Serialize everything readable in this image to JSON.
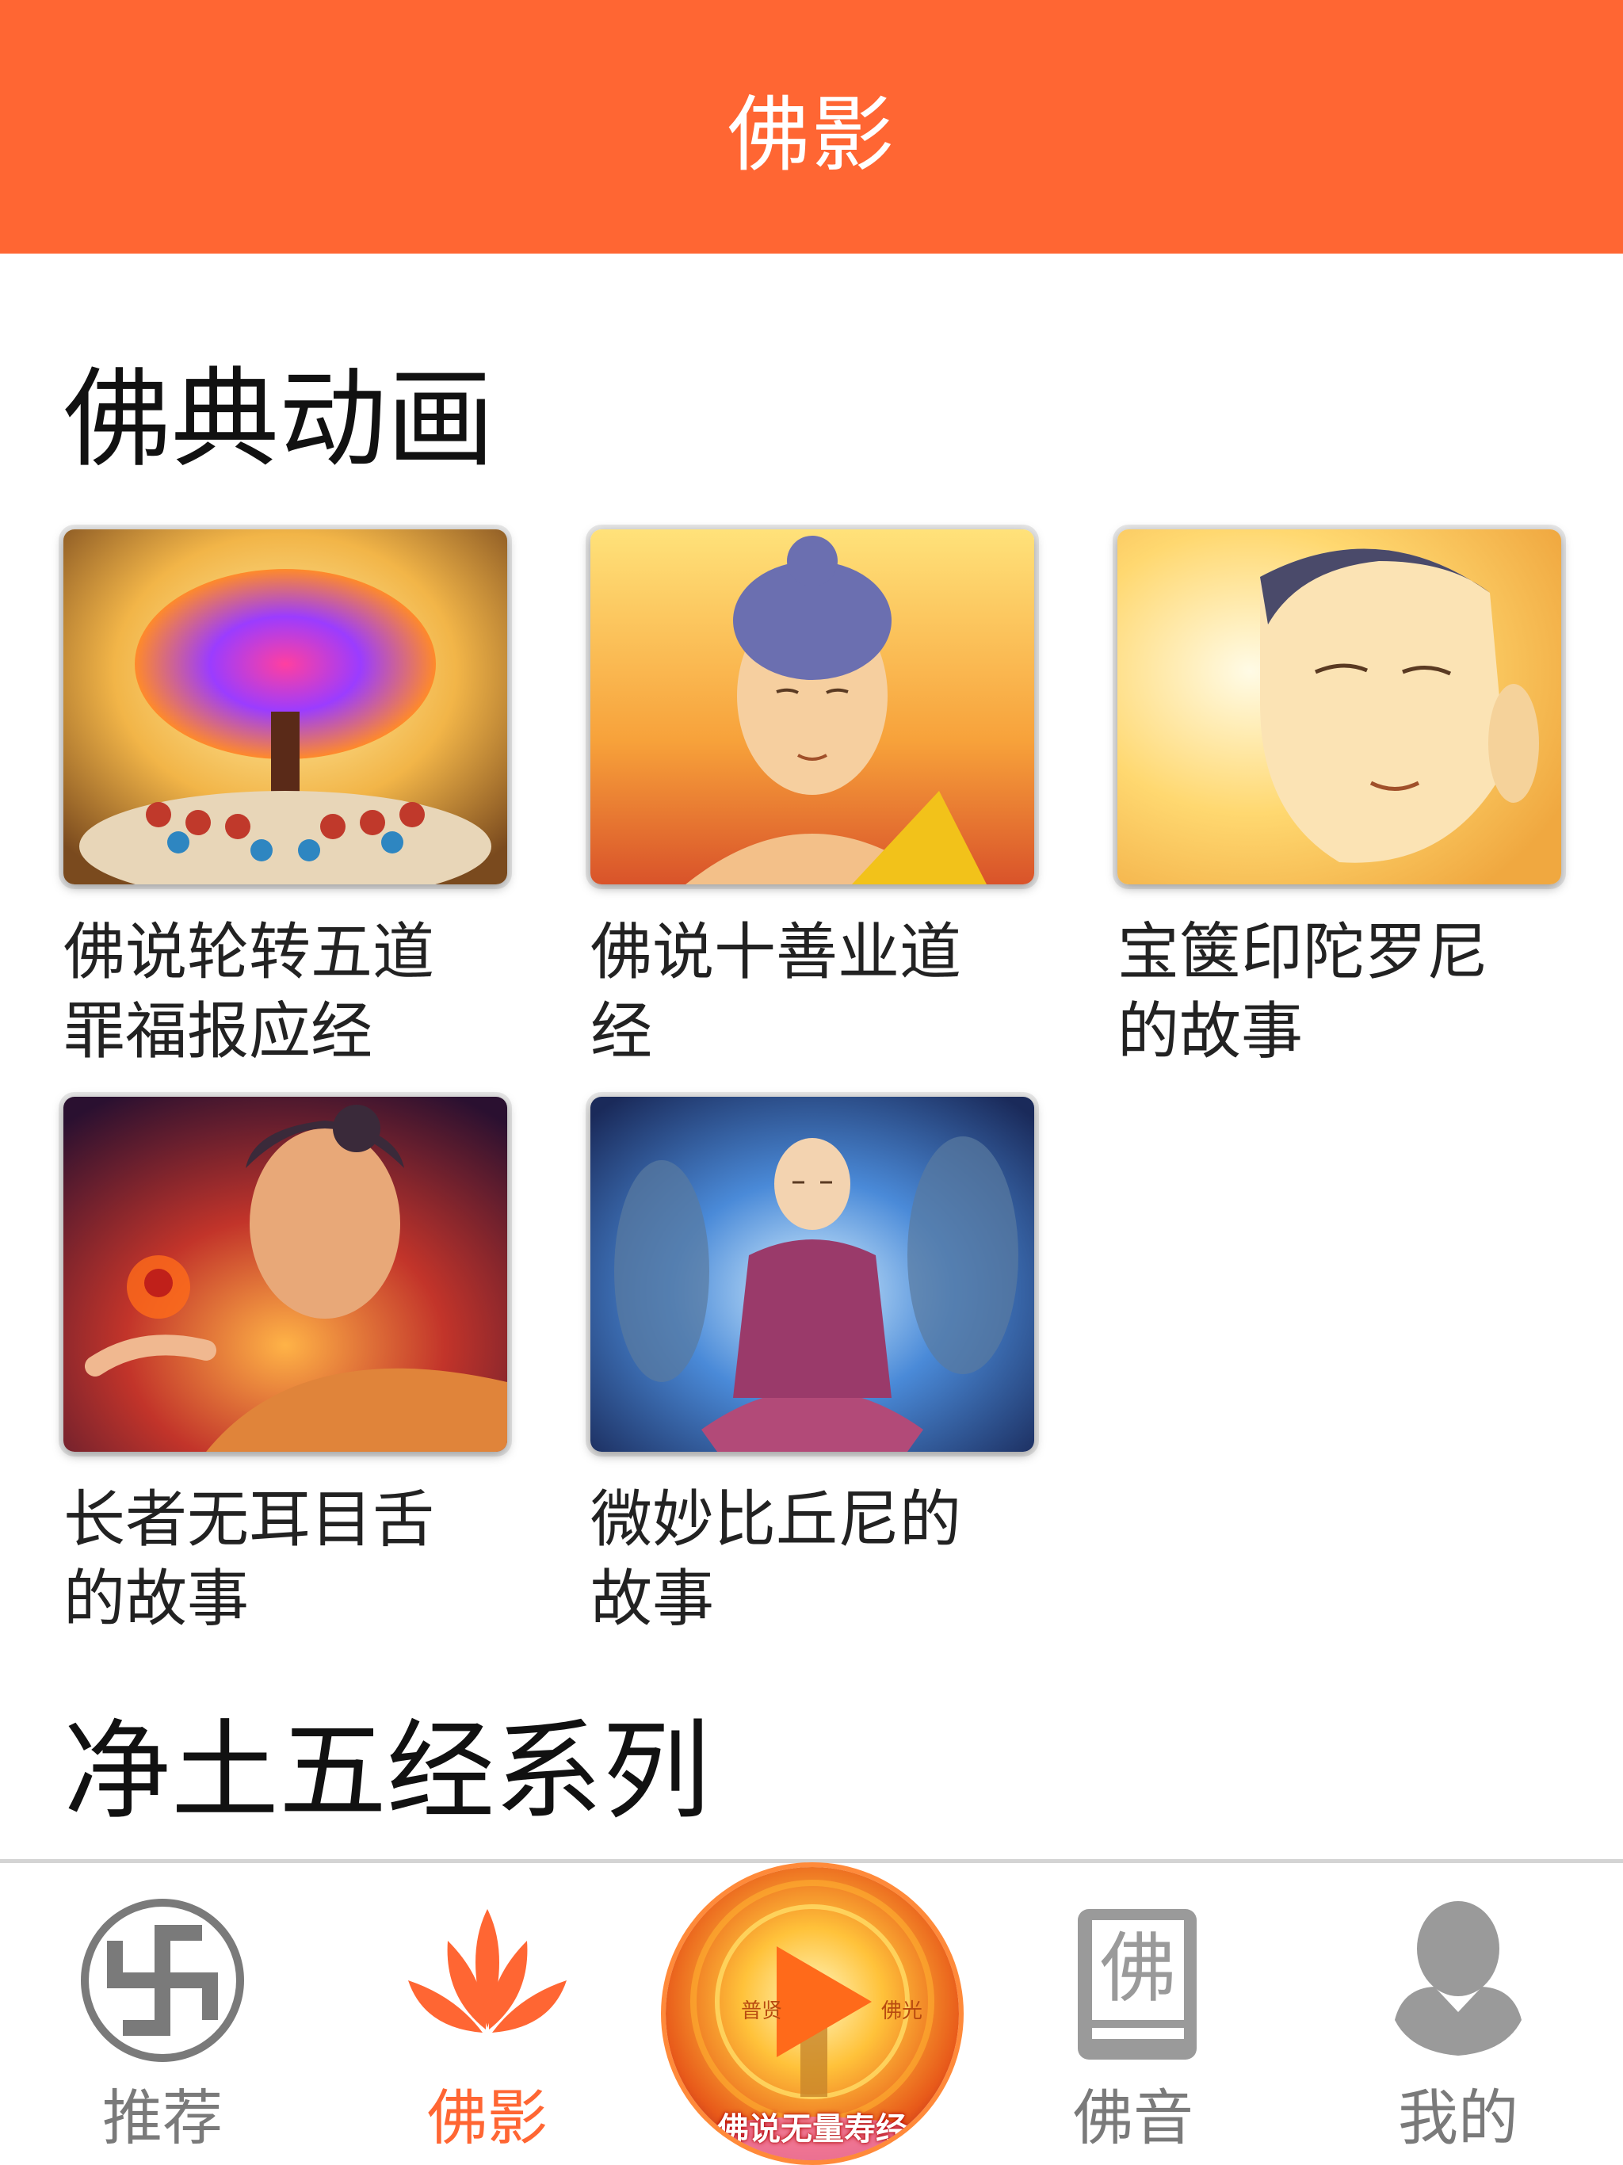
{
  "header": {
    "title": "佛影"
  },
  "sections": [
    {
      "title": "佛典动画",
      "items": [
        {
          "caption": "佛说轮转五道罪福报应经",
          "image_desc": "bodhi-tree-gathering"
        },
        {
          "caption": "佛说十善业道经",
          "image_desc": "buddha-portrait-golden"
        },
        {
          "caption": "宝箧印陀罗尼的故事",
          "image_desc": "buddha-face-light"
        },
        {
          "caption": "长者无耳目舌的故事",
          "image_desc": "buddha-cosmic-child"
        },
        {
          "caption": "微妙比丘尼的故事",
          "image_desc": "meditating-nun"
        }
      ]
    },
    {
      "title": "净土五经系列"
    }
  ],
  "bottom_nav": {
    "items": [
      {
        "label": "推荐",
        "icon": "swastika-icon",
        "active": false
      },
      {
        "label": "佛影",
        "icon": "lotus-icon",
        "active": true
      },
      {
        "label": "佛音",
        "icon": "buddha-book-icon",
        "active": false
      },
      {
        "label": "我的",
        "icon": "person-icon",
        "active": false
      }
    ],
    "center_player": {
      "caption": "佛说无量寿经",
      "left_text": "普贤",
      "right_text": "佛光",
      "icon": "play-icon"
    }
  },
  "colors": {
    "accent": "#ff6633",
    "nav_inactive": "#7a7a7a",
    "divider": "#d4d4d4"
  }
}
